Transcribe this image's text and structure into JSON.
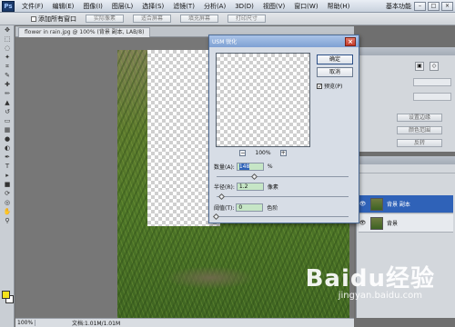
{
  "menu": {
    "items": [
      "文件(F)",
      "编辑(E)",
      "图像(I)",
      "图层(L)",
      "选择(S)",
      "滤镜(T)",
      "分析(A)",
      "3D(D)",
      "视图(V)",
      "窗口(W)",
      "帮助(H)"
    ],
    "workspace": "基本功能",
    "logo": "Ps"
  },
  "options_bar": {
    "checkbox_label": "添加所有窗口",
    "buttons": [
      "实际像素",
      "适合屏幕",
      "填充屏幕",
      "打印尺寸"
    ]
  },
  "document": {
    "tab_label": "flower in rain.jpg @ 100% (背景 副本, LAB/8)",
    "zoom": "100%",
    "doc_size": "文档:1.01M/1.01M"
  },
  "dialog": {
    "title": "USM 锐化",
    "ok_label": "确定",
    "cancel_label": "取消",
    "preview_label": "预览(P)",
    "preview_checked": true,
    "preview_zoom": "100%",
    "zoom_minus": "−",
    "zoom_plus": "+",
    "amount_label": "数量(A):",
    "amount_value": "148",
    "amount_unit": "%",
    "radius_label": "半径(R):",
    "radius_value": "1.2",
    "radius_unit": "像素",
    "threshold_label": "阈值(T):",
    "threshold_value": "0",
    "threshold_unit": "色阶",
    "amount_slider_pct": 0.29,
    "radius_slider_pct": 0.04,
    "threshold_slider_pct": 0.0
  },
  "panels": {
    "adjust_buttons": [
      "设置边缘",
      "颜色范围",
      "反转"
    ],
    "layers": [
      {
        "name": "背景 副本",
        "selected": true
      },
      {
        "name": "背景",
        "selected": false
      }
    ]
  },
  "watermark": {
    "brand": "Baidu经验",
    "url": "jingyan.baidu.com"
  }
}
